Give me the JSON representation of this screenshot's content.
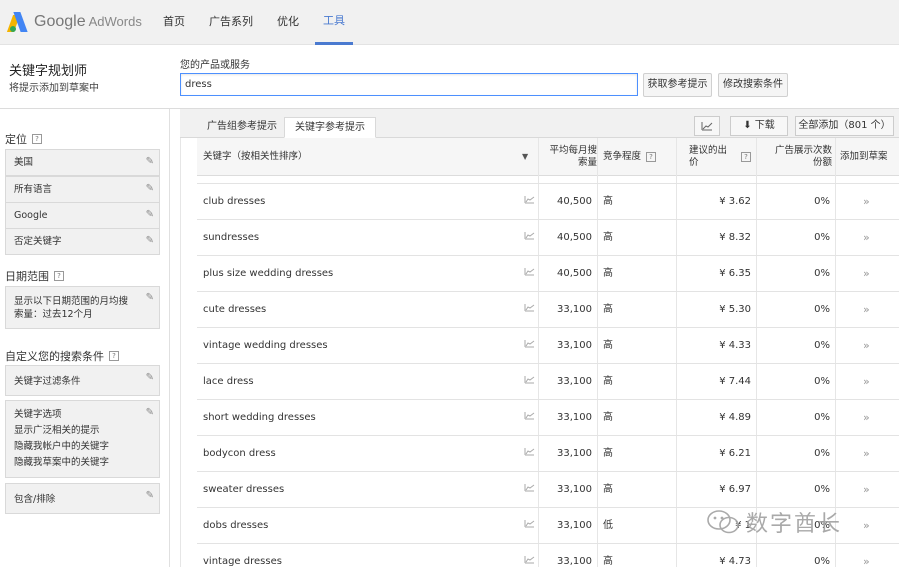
{
  "app": {
    "name": "Google",
    "product": "AdWords"
  },
  "nav": [
    {
      "label": "首页",
      "active": false
    },
    {
      "label": "广告系列",
      "active": false
    },
    {
      "label": "优化",
      "active": false
    },
    {
      "label": "工具",
      "active": true
    }
  ],
  "planner": {
    "title": "关键字规划师",
    "subtitle": "将提示添加到草案中",
    "product_label": "您的产品或服务",
    "query": "dress",
    "get_ideas_button": "获取参考提示",
    "modify_search_button": "修改搜索条件"
  },
  "sidebar": {
    "targeting_title": "定位",
    "targeting_items": [
      "美国",
      "所有语言",
      "Google",
      "否定关键字"
    ],
    "date_title": "日期范围",
    "date_text": "显示以下日期范围的月均搜索量：过去12个月",
    "custom_title": "自定义您的搜索条件",
    "filter_label": "关键字过滤条件",
    "options_lines": [
      "关键字选项",
      "显示广泛相关的提示",
      "隐藏我帐户中的关键字",
      "隐藏我草案中的关键字"
    ],
    "include_exclude": "包含/排除"
  },
  "tabs": {
    "ad_group_ideas": "广告组参考提示",
    "keyword_ideas": "关键字参考提示",
    "download": "下载",
    "add_all": "全部添加（801 个）"
  },
  "table": {
    "headers": {
      "keyword": "关键字（按相关性排序）",
      "volume": "平均每月搜索量",
      "competition": "竞争程度",
      "bid": "建议的出价",
      "share": "广告展示次数份额",
      "add": "添加到草案"
    },
    "rows": [
      {
        "keyword": "club dresses",
        "volume": "40,500",
        "competition": "高",
        "bid": "¥ 3.62",
        "share": "0%"
      },
      {
        "keyword": "sundresses",
        "volume": "40,500",
        "competition": "高",
        "bid": "¥ 8.32",
        "share": "0%"
      },
      {
        "keyword": "plus size wedding dresses",
        "volume": "40,500",
        "competition": "高",
        "bid": "¥ 6.35",
        "share": "0%"
      },
      {
        "keyword": "cute dresses",
        "volume": "33,100",
        "competition": "高",
        "bid": "¥ 5.30",
        "share": "0%"
      },
      {
        "keyword": "vintage wedding dresses",
        "volume": "33,100",
        "competition": "高",
        "bid": "¥ 4.33",
        "share": "0%"
      },
      {
        "keyword": "lace dress",
        "volume": "33,100",
        "competition": "高",
        "bid": "¥ 7.44",
        "share": "0%"
      },
      {
        "keyword": "short wedding dresses",
        "volume": "33,100",
        "competition": "高",
        "bid": "¥ 4.89",
        "share": "0%"
      },
      {
        "keyword": "bodycon dress",
        "volume": "33,100",
        "competition": "高",
        "bid": "¥ 6.21",
        "share": "0%"
      },
      {
        "keyword": "sweater dresses",
        "volume": "33,100",
        "competition": "高",
        "bid": "¥ 6.97",
        "share": "0%"
      },
      {
        "keyword": "dobs dresses",
        "volume": "33,100",
        "competition": "低",
        "bid": "¥ 1",
        "share": "0%"
      },
      {
        "keyword": "vintage dresses",
        "volume": "33,100",
        "competition": "高",
        "bid": "¥ 4.73",
        "share": "0%"
      }
    ]
  },
  "watermark": "数字酋长",
  "icons": {
    "edit": "pencil-icon",
    "chart": "chart-icon",
    "add": "double-chevron-right-icon",
    "download": "download-icon",
    "help": "help-icon"
  },
  "colors": {
    "accent": "#4a7ad0",
    "input_focus": "#4d90fe"
  }
}
